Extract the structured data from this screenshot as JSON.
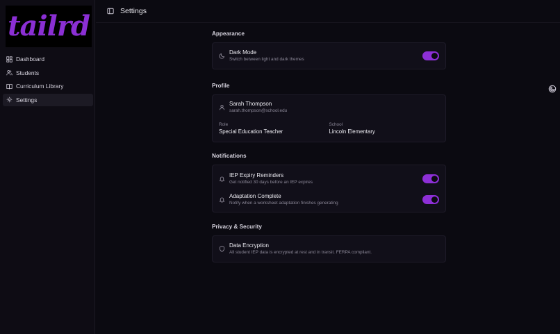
{
  "app": {
    "logo_text": "tailrd",
    "page_title": "Settings"
  },
  "sidebar": {
    "items": [
      {
        "label": "Dashboard",
        "icon": "dashboard-icon"
      },
      {
        "label": "Students",
        "icon": "users-icon"
      },
      {
        "label": "Curriculum Library",
        "icon": "book-icon"
      },
      {
        "label": "Settings",
        "icon": "gear-icon",
        "active": true
      }
    ]
  },
  "appearance": {
    "title": "Appearance",
    "dark_mode_label": "Dark Mode",
    "dark_mode_desc": "Switch between light and dark themes",
    "dark_mode_on": true
  },
  "profile": {
    "title": "Profile",
    "name": "Sarah Thompson",
    "email": "sarah.thompson@school.edu",
    "role_label": "Role",
    "role_value": "Special Education Teacher",
    "school_label": "School",
    "school_value": "Lincoln Elementary"
  },
  "notifications": {
    "title": "Notifications",
    "iep_label": "IEP Expiry Reminders",
    "iep_desc": "Get notified 30 days before an IEP expires",
    "iep_on": true,
    "adapt_label": "Adaptation Complete",
    "adapt_desc": "Notify when a worksheet adaptation finishes generating",
    "adapt_on": true
  },
  "privacy": {
    "title": "Privacy & Security",
    "enc_label": "Data Encryption",
    "enc_desc": "All student IEP data is encrypted at rest and in transit. FERPA compliant."
  },
  "colors": {
    "accent": "#8d2fd6",
    "background": "#0b0a11",
    "card": "#110f19"
  }
}
